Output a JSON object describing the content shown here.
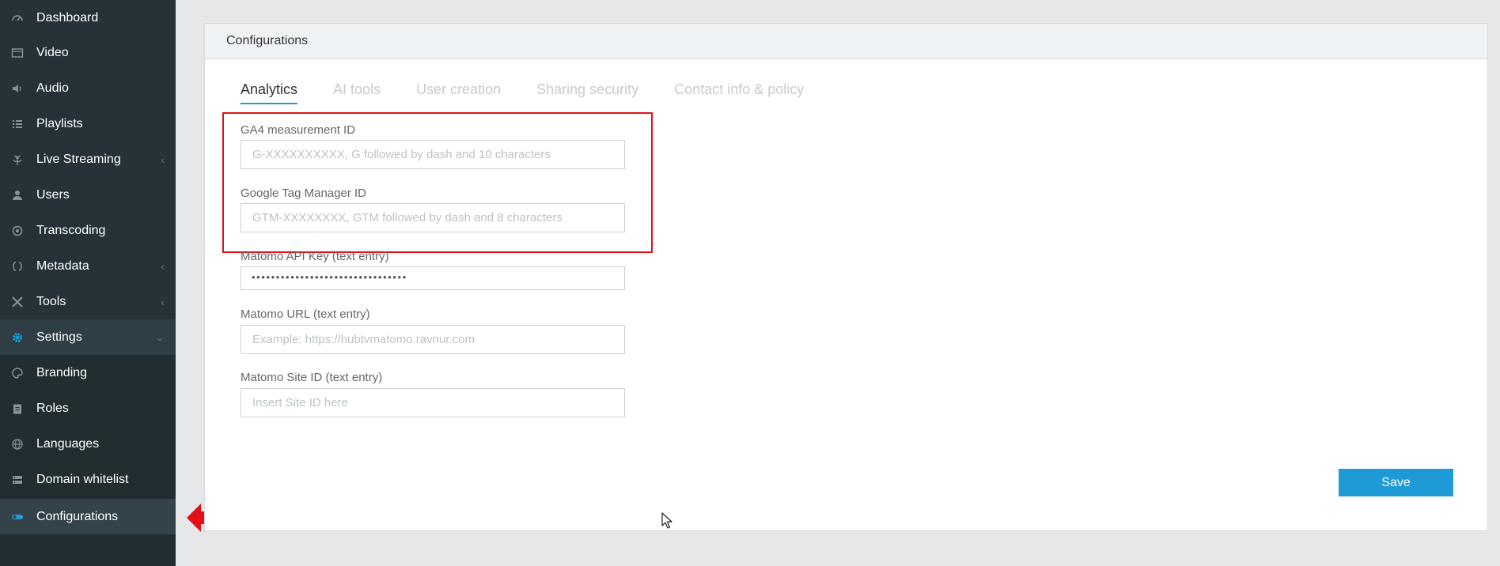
{
  "sidebar": {
    "items": [
      {
        "label": "Dashboard",
        "icon": "dashboard-icon"
      },
      {
        "label": "Video",
        "icon": "video-icon"
      },
      {
        "label": "Audio",
        "icon": "audio-icon"
      },
      {
        "label": "Playlists",
        "icon": "playlists-icon"
      },
      {
        "label": "Live Streaming",
        "icon": "live-streaming-icon"
      },
      {
        "label": "Users",
        "icon": "user-icon"
      },
      {
        "label": "Transcoding",
        "icon": "transcoding-icon"
      },
      {
        "label": "Metadata",
        "icon": "metadata-icon"
      },
      {
        "label": "Tools",
        "icon": "tools-icon"
      },
      {
        "label": "Settings",
        "icon": "gear-icon"
      },
      {
        "label": "Branding",
        "icon": "palette-icon"
      },
      {
        "label": "Roles",
        "icon": "clipboard-icon"
      },
      {
        "label": "Languages",
        "icon": "globe-icon"
      },
      {
        "label": "Domain whitelist",
        "icon": "server-icon"
      },
      {
        "label": "Configurations",
        "icon": "toggle-icon"
      }
    ]
  },
  "panel": {
    "title": "Configurations"
  },
  "tabs": [
    {
      "label": "Analytics"
    },
    {
      "label": "AI tools"
    },
    {
      "label": "User creation"
    },
    {
      "label": "Sharing security"
    },
    {
      "label": "Contact info & policy"
    }
  ],
  "fields": {
    "ga4": {
      "label": "GA4 measurement ID",
      "placeholder": "G-XXXXXXXXXX, G followed by dash and 10 characters"
    },
    "gtm": {
      "label": "Google Tag Manager ID",
      "placeholder": "GTM-XXXXXXXX, GTM followed by dash and 8 characters"
    },
    "matomo_key": {
      "label": "Matomo API Key (text entry)",
      "value": "••••••••••••••••••••••••••••••••"
    },
    "matomo_url": {
      "label": "Matomo URL (text entry)",
      "placeholder": "Example: https://hubtvmatomo.ravnur.com"
    },
    "matomo_site": {
      "label": "Matomo Site ID (text entry)",
      "placeholder": "Insert Site ID here"
    }
  },
  "actions": {
    "save_label": "Save"
  },
  "colors": {
    "accent": "#1e9bd7",
    "sidebar": "#263238",
    "highlight": "#e3101a"
  }
}
